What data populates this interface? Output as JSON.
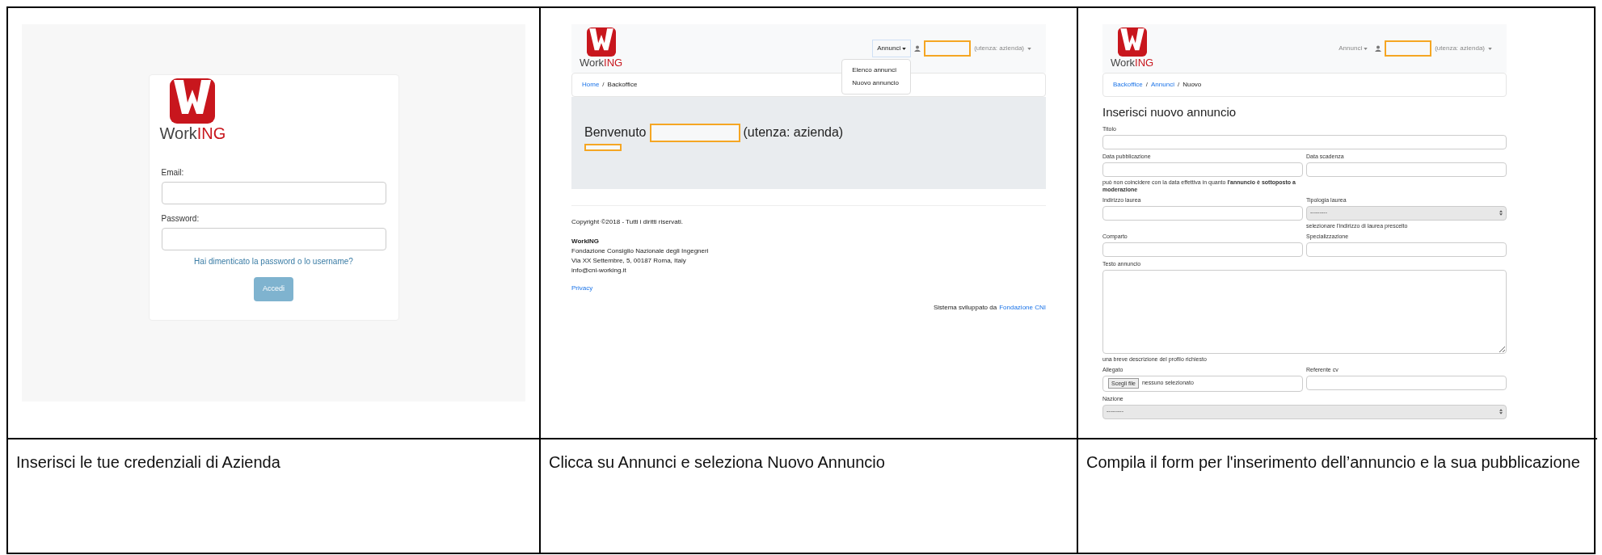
{
  "steps": [
    {
      "kind": "login",
      "caption": "Inserisci le tue credenziali di Azienda",
      "screen": {
        "logo": {
          "dark": "Work",
          "red": "ING"
        },
        "fields": [
          {
            "label": "Email:"
          },
          {
            "label": "Password:"
          }
        ],
        "forgot_link": "Hai dimenticato la password o lo username?",
        "submit": "Accedi"
      }
    },
    {
      "kind": "backoffice",
      "caption": "Clicca su Annunci e seleziona Nuovo Annuncio",
      "screen": {
        "logo": {
          "dark": "Work",
          "red": "ING"
        },
        "menu": {
          "label": "Annunci",
          "expanded": true,
          "items": [
            "Elenco annunci",
            "Nuovo annuncio"
          ]
        },
        "user": "(utenza: azienda)",
        "breadcrumb_separator": "/",
        "breadcrumb": [
          {
            "text": "Home",
            "link": true
          },
          {
            "text": "Backoffice",
            "link": false
          }
        ],
        "welcome": "Benvenuto",
        "welcome_role": "(utenza: azienda)",
        "copyright": "Copyright ©2018 - Tutti i diritti riservati.",
        "company": "WorkING",
        "address": [
          "Fondazione Consiglio Nazionale degli Ingegneri",
          "Via XX Settembre, 5, 00187 Roma, Italy",
          "info@cni-working.it"
        ],
        "privacy": "Privacy",
        "credit": "Sistema sviluppato da",
        "credit_link": "Fondazione CNI"
      }
    },
    {
      "kind": "form",
      "caption": "Compila il form per l'inserimento dell’annuncio e la sua pubblicazione",
      "screen": {
        "logo": {
          "dark": "Work",
          "red": "ING"
        },
        "menu": {
          "label": "Annunci",
          "expanded": false
        },
        "user": "(utenza: azienda)",
        "breadcrumb_separator": "/",
        "breadcrumb": [
          {
            "text": "Backoffice",
            "link": true
          },
          {
            "text": "Annunci",
            "link": true
          },
          {
            "text": "Nuovo",
            "link": false
          }
        ],
        "heading": "Inserisci nuovo annuncio",
        "fields": [
          {
            "kind": "text",
            "wide": true,
            "label": "Titolo"
          },
          {
            "kind": "text",
            "wide": false,
            "label": "Data pubblicazione",
            "help": "può non coincidere con la data effettiva in quanto **l'annuncio è sottoposto a moderazione**"
          },
          {
            "kind": "text",
            "wide": false,
            "label": "Data scadenza"
          },
          {
            "kind": "text",
            "wide": false,
            "label": "Indirizzo laurea"
          },
          {
            "kind": "select",
            "wide": false,
            "label": "Tipologia laurea",
            "value": "---------",
            "help": "selezionare l'indirizzo di laurea prescelto"
          },
          {
            "kind": "text",
            "wide": false,
            "label": "Comparto"
          },
          {
            "kind": "text",
            "wide": false,
            "label": "Specializzazione"
          },
          {
            "kind": "textarea",
            "wide": true,
            "label": "Testo annuncio",
            "help": "una breve descrizione del profilo richiesto"
          },
          {
            "kind": "file",
            "wide": false,
            "label": "Allegato",
            "button": "Scegli file",
            "status": "nessuno selezionato"
          },
          {
            "kind": "text",
            "wide": false,
            "label": "Referente cv"
          },
          {
            "kind": "select",
            "wide": true,
            "label": "Nazione",
            "value": "---------"
          }
        ]
      }
    }
  ]
}
